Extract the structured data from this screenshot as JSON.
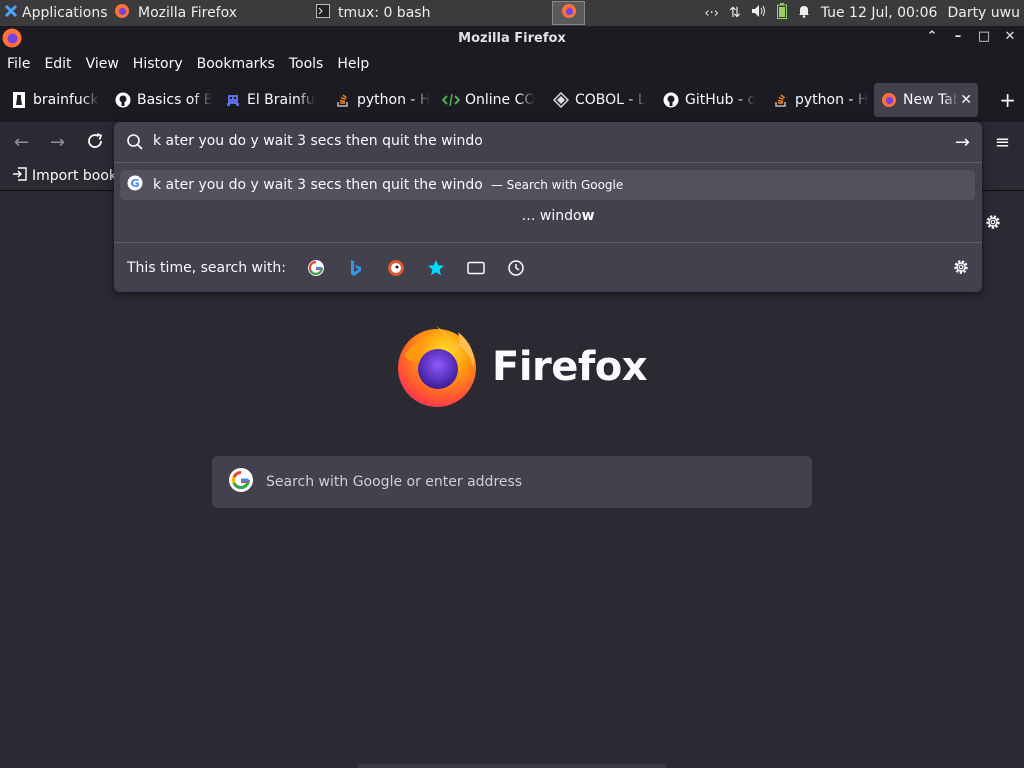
{
  "panel": {
    "apps_label": "Applications",
    "tasks": [
      {
        "label": "Mozilla Firefox",
        "icon": "firefox-icon"
      },
      {
        "label": "tmux: 0 bash",
        "icon": "terminal-icon"
      }
    ],
    "datetime": "Tue 12 Jul, 00:06",
    "user": "Darty uwu"
  },
  "window": {
    "title": "Mozilla Firefox",
    "controls": {
      "up": "⌃",
      "min": "–",
      "max": "□",
      "close": "✕"
    }
  },
  "menubar": {
    "items": [
      "File",
      "Edit",
      "View",
      "History",
      "Bookmarks",
      "Tools",
      "Help"
    ]
  },
  "tabs": [
    {
      "title": "brainfuck",
      "icon": "chess-piece-icon"
    },
    {
      "title": "Basics of B",
      "icon": "github-icon"
    },
    {
      "title": "El Brainfu",
      "icon": "space-invader-icon"
    },
    {
      "title": "python - H",
      "icon": "stackoverflow-icon"
    },
    {
      "title": "Online CO",
      "icon": "code-icon"
    },
    {
      "title": "COBOL - L",
      "icon": "cobol-icon"
    },
    {
      "title": "GitHub - c",
      "icon": "github-icon"
    },
    {
      "title": "python - H",
      "icon": "stackoverflow-icon"
    },
    {
      "title": "New Tab",
      "icon": "firefox-icon",
      "selected": true
    }
  ],
  "bookmarks": {
    "import_label": "Import book"
  },
  "urlbar": {
    "value": "k ater you do y wait 3 secs then quit the windo",
    "result_text": "k ater you do y wait 3 secs then quit the windo",
    "result_action": "— Search with Google",
    "suggestion_prefix": "… windo",
    "suggestion_bold": "w",
    "oneoff_label": "This time, search with:",
    "oneoff_engines": [
      "google",
      "bing",
      "duckduckgo",
      "bookmarks",
      "tabs",
      "history"
    ]
  },
  "newtab": {
    "wordmark": "Firefox",
    "search_placeholder": "Search with Google or enter address"
  },
  "colors": {
    "background": "#2b2a33",
    "toolbar": "#1c1b22",
    "popup": "#42414d",
    "selected_result": "#52515e"
  }
}
